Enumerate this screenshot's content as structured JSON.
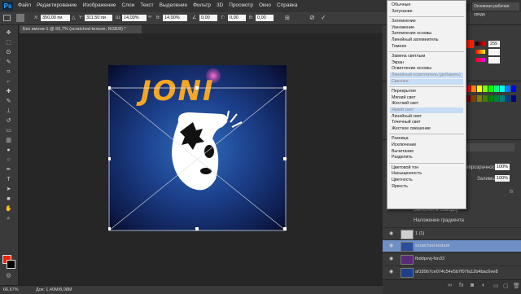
{
  "app": {
    "logo": "Ps"
  },
  "menu": [
    "Файл",
    "Редактирование",
    "Изображение",
    "Слои",
    "Текст",
    "Выделение",
    "Фильтр",
    "3D",
    "Просмотр",
    "Окно",
    "Справка"
  ],
  "options": {
    "x_label": "X:",
    "x_value": "350,00 пи",
    "y_label": "Y:",
    "y_value": "311,50 пи",
    "w_label": "Ш:",
    "w_value": "14,00%",
    "h_label": "В:",
    "h_value": "14,00%",
    "angle_value": "0,00",
    "h_skew_label": "Г:",
    "h_skew_value": "0,00",
    "v_skew_label": "В:",
    "v_skew_value": "0,00"
  },
  "tab": {
    "title": "Без имени-1 @ 66,7% (scratched-texture, RGB/8) *"
  },
  "artwork": {
    "title": "JONI"
  },
  "status": {
    "zoom": "66,67%",
    "doc": "Док: 1,40M/8,08M"
  },
  "right": {
    "workspace_label": "Основная рабочая среда"
  },
  "blend_groups": [
    [
      "Обычные",
      "Затухание"
    ],
    [
      "Затемнение",
      "Умножение",
      "Затемнение основы",
      "Линейный затемнитель",
      "Темнее"
    ],
    [
      "Замена светлым",
      "Экран",
      "Осветление основы",
      "Линейный осветлитель (добавить)",
      "Светлее"
    ],
    [
      "Перекрытие",
      "Мягкий свет",
      "Жесткий свет",
      "Яркий свет",
      "Линейный свет",
      "Точечный свет",
      "Жесткое смешение"
    ],
    [
      "Разница",
      "Исключение",
      "Вычитание",
      "Разделить"
    ],
    [
      "Цветовой тон",
      "Насыщенность",
      "Цветность",
      "Яркость"
    ]
  ],
  "color_panel": {
    "r": "255",
    "g": "",
    "b": ""
  },
  "layers_panel": {
    "opacity_label": "Непрозрачность:",
    "opacity_value": "100%",
    "fill_label": "Заливка:",
    "fill_value": "100%"
  },
  "effects": [
    "Выполнить обводку",
    "Наложение градиента"
  ],
  "layers": [
    {
      "name": "1 (1)"
    },
    {
      "name": "scratched-texture"
    },
    {
      "name": "fbddpvvj-fon33"
    },
    {
      "name": "af189b7ce074c54e5b7f07fa12b4bac6ee8"
    }
  ],
  "colors": {
    "swatch_row1": [
      "#ff0000",
      "#ff7f00",
      "#ffff00",
      "#7fff00",
      "#00ff00",
      "#00ff7f",
      "#00ffff",
      "#007fff",
      "#0000ff"
    ],
    "swatch_row2": [
      "#7f0000",
      "#7f3f00",
      "#7f7f00",
      "#3f7f00",
      "#007f00",
      "#007f3f",
      "#007f7f",
      "#003f7f",
      "#00007f"
    ]
  }
}
